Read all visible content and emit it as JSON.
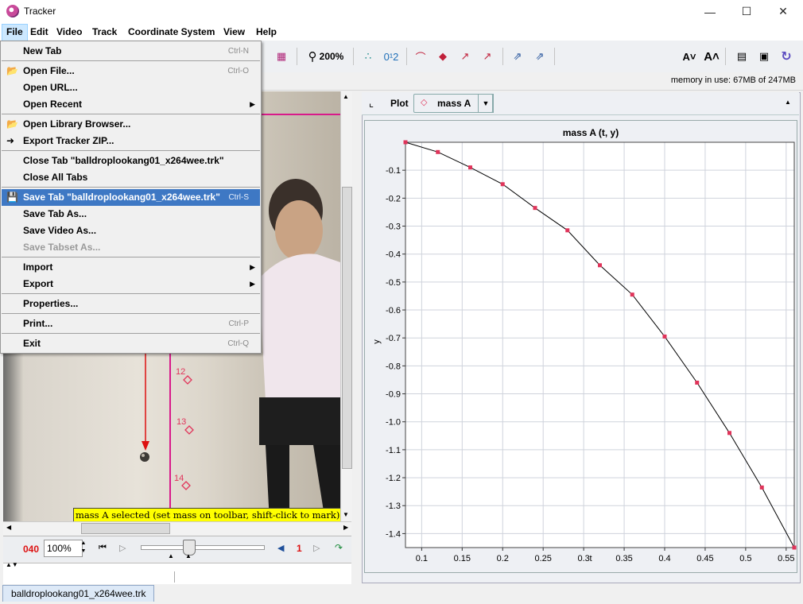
{
  "window": {
    "title": "Tracker"
  },
  "menubar": [
    "File",
    "Edit",
    "Video",
    "Track",
    "Coordinate System",
    "View",
    "Help"
  ],
  "toolbar": {
    "zoom": "200%",
    "coord_label": "0¹2",
    "font_smaller": "A˅",
    "font_larger": "A˄"
  },
  "memory": "memory in use: 67MB of 247MB",
  "file_menu": [
    {
      "label": "New Tab",
      "acc": "Ctrl-N",
      "icon": ""
    },
    {
      "sep": true
    },
    {
      "label": "Open File...",
      "acc": "Ctrl-O",
      "icon": "open-folder-icon"
    },
    {
      "label": "Open URL...",
      "acc": "",
      "icon": ""
    },
    {
      "label": "Open Recent",
      "acc": "",
      "icon": "",
      "sub": true
    },
    {
      "sep": true
    },
    {
      "label": "Open Library Browser...",
      "acc": "",
      "icon": "library-folder-icon"
    },
    {
      "label": "Export Tracker ZIP...",
      "acc": "",
      "icon": "export-zip-icon"
    },
    {
      "sep": true
    },
    {
      "label": "Close Tab \"balldroplookang01_x264wee.trk\"",
      "acc": "",
      "icon": ""
    },
    {
      "label": "Close All Tabs",
      "acc": "",
      "icon": ""
    },
    {
      "sep": true
    },
    {
      "label": "Save Tab \"balldroplookang01_x264wee.trk\"",
      "acc": "Ctrl-S",
      "icon": "floppy-disk-icon",
      "hl": true
    },
    {
      "label": "Save Tab As...",
      "acc": "",
      "icon": ""
    },
    {
      "label": "Save Video As...",
      "acc": "",
      "icon": ""
    },
    {
      "label": "Save Tabset As...",
      "acc": "",
      "icon": "",
      "dis": true
    },
    {
      "sep": true
    },
    {
      "label": "Import",
      "acc": "",
      "icon": "",
      "sub": true
    },
    {
      "label": "Export",
      "acc": "",
      "icon": "",
      "sub": true
    },
    {
      "sep": true
    },
    {
      "label": "Properties...",
      "acc": "",
      "icon": ""
    },
    {
      "sep": true
    },
    {
      "label": "Print...",
      "acc": "Ctrl-P",
      "icon": ""
    },
    {
      "sep": true
    },
    {
      "label": "Exit",
      "acc": "Ctrl-Q",
      "icon": ""
    }
  ],
  "video": {
    "frame_markers": [
      "12",
      "13",
      "14"
    ],
    "status_tip": "mass A selected (set mass on toolbar, shift-click to mark)"
  },
  "player": {
    "frame": "040",
    "zoom": "100%",
    "step": "1"
  },
  "plot": {
    "button": "Plot",
    "track": "mass A"
  },
  "colors": {
    "marker": "#e0345a",
    "highlight": "#3e78c4",
    "track": "#d81a8a"
  },
  "tab": {
    "label": "balldroplookang01_x264wee.trk"
  },
  "chart_data": {
    "type": "line",
    "title": "mass A (t, y)",
    "xlabel": "t",
    "ylabel": "y",
    "xlim": [
      0.08,
      0.56
    ],
    "ylim": [
      -1.45,
      0.0
    ],
    "xticks": [
      0.1,
      0.15,
      0.2,
      0.25,
      0.3,
      0.35,
      0.4,
      0.45,
      0.5,
      0.55
    ],
    "yticks": [
      -0.1,
      -0.2,
      -0.3,
      -0.4,
      -0.5,
      -0.6,
      -0.7,
      -0.8,
      -0.9,
      -1.0,
      -1.1,
      -1.2,
      -1.3,
      -1.4
    ],
    "grid": true,
    "series": [
      {
        "x": [
          0.08,
          0.12,
          0.16,
          0.2,
          0.24,
          0.28,
          0.32,
          0.36,
          0.4,
          0.44,
          0.48,
          0.52,
          0.56
        ],
        "y": [
          0.0,
          -0.035,
          -0.09,
          -0.15,
          -0.235,
          -0.315,
          -0.44,
          -0.545,
          -0.695,
          -0.86,
          -1.04,
          -1.235,
          -1.45
        ]
      }
    ]
  }
}
